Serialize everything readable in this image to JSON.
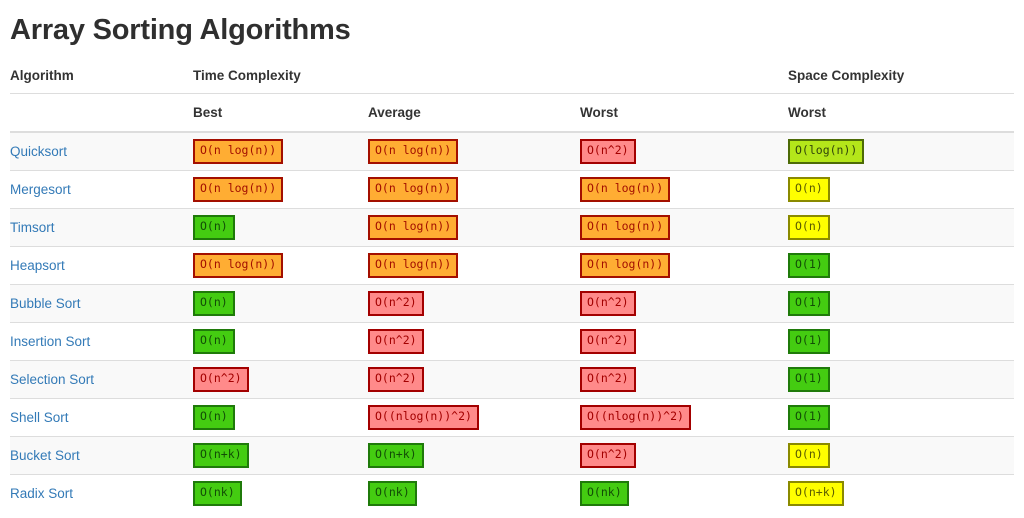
{
  "page": {
    "title": "Array Sorting Algorithms"
  },
  "table": {
    "group_headers": {
      "algorithm": "Algorithm",
      "time_complexity": "Time Complexity",
      "space_complexity": "Space Complexity"
    },
    "sub_headers": {
      "algorithm": "",
      "best": "Best",
      "average": "Average",
      "worst": "Worst",
      "space_worst": "Worst"
    },
    "rows": [
      {
        "algorithm": "Quicksort",
        "best": {
          "text": "O(n log(n))",
          "color": "orange"
        },
        "average": {
          "text": "O(n log(n))",
          "color": "orange"
        },
        "worst": {
          "text": "O(n^2)",
          "color": "red"
        },
        "space_worst": {
          "text": "O(log(n))",
          "color": "yellowgreen"
        }
      },
      {
        "algorithm": "Mergesort",
        "best": {
          "text": "O(n log(n))",
          "color": "orange"
        },
        "average": {
          "text": "O(n log(n))",
          "color": "orange"
        },
        "worst": {
          "text": "O(n log(n))",
          "color": "orange"
        },
        "space_worst": {
          "text": "O(n)",
          "color": "yellow"
        }
      },
      {
        "algorithm": "Timsort",
        "best": {
          "text": "O(n)",
          "color": "green"
        },
        "average": {
          "text": "O(n log(n))",
          "color": "orange"
        },
        "worst": {
          "text": "O(n log(n))",
          "color": "orange"
        },
        "space_worst": {
          "text": "O(n)",
          "color": "yellow"
        }
      },
      {
        "algorithm": "Heapsort",
        "best": {
          "text": "O(n log(n))",
          "color": "orange"
        },
        "average": {
          "text": "O(n log(n))",
          "color": "orange"
        },
        "worst": {
          "text": "O(n log(n))",
          "color": "orange"
        },
        "space_worst": {
          "text": "O(1)",
          "color": "green"
        }
      },
      {
        "algorithm": "Bubble Sort",
        "best": {
          "text": "O(n)",
          "color": "green"
        },
        "average": {
          "text": "O(n^2)",
          "color": "red"
        },
        "worst": {
          "text": "O(n^2)",
          "color": "red"
        },
        "space_worst": {
          "text": "O(1)",
          "color": "green"
        }
      },
      {
        "algorithm": "Insertion Sort",
        "best": {
          "text": "O(n)",
          "color": "green"
        },
        "average": {
          "text": "O(n^2)",
          "color": "red"
        },
        "worst": {
          "text": "O(n^2)",
          "color": "red"
        },
        "space_worst": {
          "text": "O(1)",
          "color": "green"
        }
      },
      {
        "algorithm": "Selection Sort",
        "best": {
          "text": "O(n^2)",
          "color": "red"
        },
        "average": {
          "text": "O(n^2)",
          "color": "red"
        },
        "worst": {
          "text": "O(n^2)",
          "color": "red"
        },
        "space_worst": {
          "text": "O(1)",
          "color": "green"
        }
      },
      {
        "algorithm": "Shell Sort",
        "best": {
          "text": "O(n)",
          "color": "green"
        },
        "average": {
          "text": "O((nlog(n))^2)",
          "color": "red"
        },
        "worst": {
          "text": "O((nlog(n))^2)",
          "color": "red"
        },
        "space_worst": {
          "text": "O(1)",
          "color": "green"
        }
      },
      {
        "algorithm": "Bucket Sort",
        "best": {
          "text": "O(n+k)",
          "color": "green"
        },
        "average": {
          "text": "O(n+k)",
          "color": "green"
        },
        "worst": {
          "text": "O(n^2)",
          "color": "red"
        },
        "space_worst": {
          "text": "O(n)",
          "color": "yellow"
        }
      },
      {
        "algorithm": "Radix Sort",
        "best": {
          "text": "O(nk)",
          "color": "green"
        },
        "average": {
          "text": "O(nk)",
          "color": "green"
        },
        "worst": {
          "text": "O(nk)",
          "color": "green"
        },
        "space_worst": {
          "text": "O(n+k)",
          "color": "yellow"
        }
      }
    ]
  },
  "colors": {
    "link": "#337ab7",
    "green": "#44cc11",
    "yellowgreen": "#b4e61a",
    "yellow": "#ffff00",
    "orange": "#ffad33",
    "red": "#ff8a8a",
    "stripe": "#f9f9f9",
    "border": "#dddddd"
  }
}
